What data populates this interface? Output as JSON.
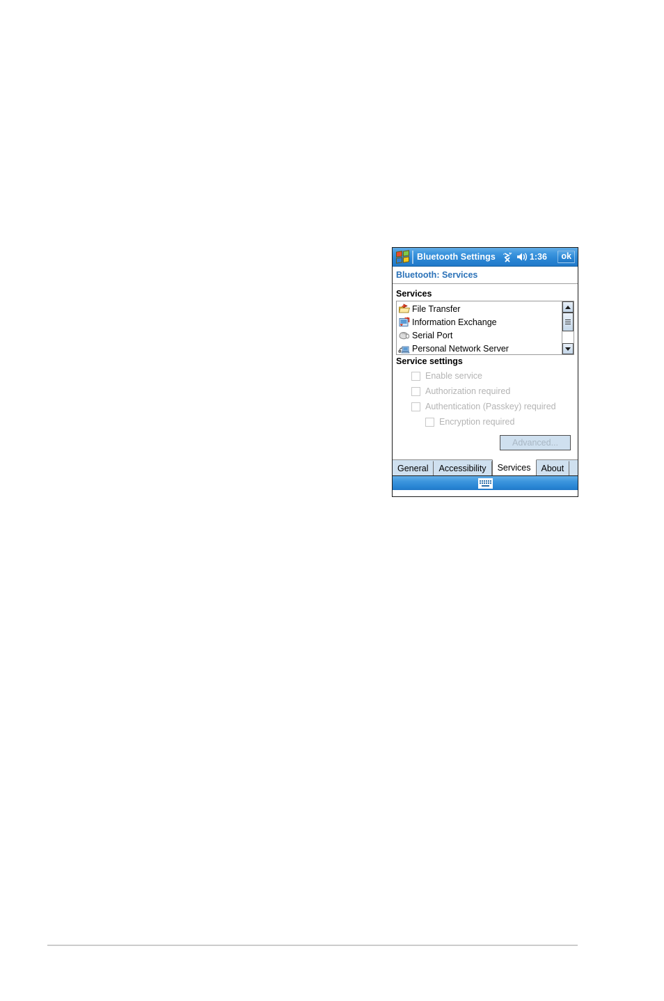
{
  "window": {
    "titlebar": {
      "start_icon": "windows-flag-icon",
      "title": "Bluetooth Settings",
      "status_icons": [
        "connectivity-icon",
        "volume-icon"
      ],
      "time": "1:36",
      "ok_label": "ok"
    },
    "subtitle": "Bluetooth: Services",
    "sections": {
      "services_label": "Services",
      "service_settings_label": "Service settings"
    },
    "services_list": {
      "items": [
        {
          "label": "File Transfer",
          "icon": "file-transfer-icon"
        },
        {
          "label": "Information Exchange",
          "icon": "information-exchange-icon"
        },
        {
          "label": "Serial Port",
          "icon": "serial-port-icon"
        },
        {
          "label": "Personal Network Server",
          "icon": "personal-network-server-icon"
        }
      ],
      "scrollbar": {
        "up_icon": "scroll-up-arrow-icon",
        "down_icon": "scroll-down-arrow-icon"
      }
    },
    "service_settings": {
      "checkboxes": [
        {
          "label": "Enable service",
          "checked": false,
          "disabled": true,
          "indented": false
        },
        {
          "label": "Authorization required",
          "checked": false,
          "disabled": true,
          "indented": false
        },
        {
          "label": "Authentication (Passkey) required",
          "checked": false,
          "disabled": true,
          "indented": false
        },
        {
          "label": "Encryption required",
          "checked": false,
          "disabled": true,
          "indented": true
        }
      ],
      "advanced_button": {
        "label": "Advanced...",
        "disabled": true
      }
    },
    "tabs": [
      {
        "label": "General",
        "active": false
      },
      {
        "label": "Accessibility",
        "active": false
      },
      {
        "label": "Services",
        "active": true
      },
      {
        "label": "About",
        "active": false
      }
    ],
    "sip_bar": {
      "icon": "keyboard-icon"
    }
  },
  "colors": {
    "titlebar_blue": "#2a86d4",
    "subtitle_blue": "#2b72b8",
    "tab_blue": "#cfe0ef",
    "disabled_text": "#b4b4b4",
    "page_rule": "#cccccc"
  }
}
